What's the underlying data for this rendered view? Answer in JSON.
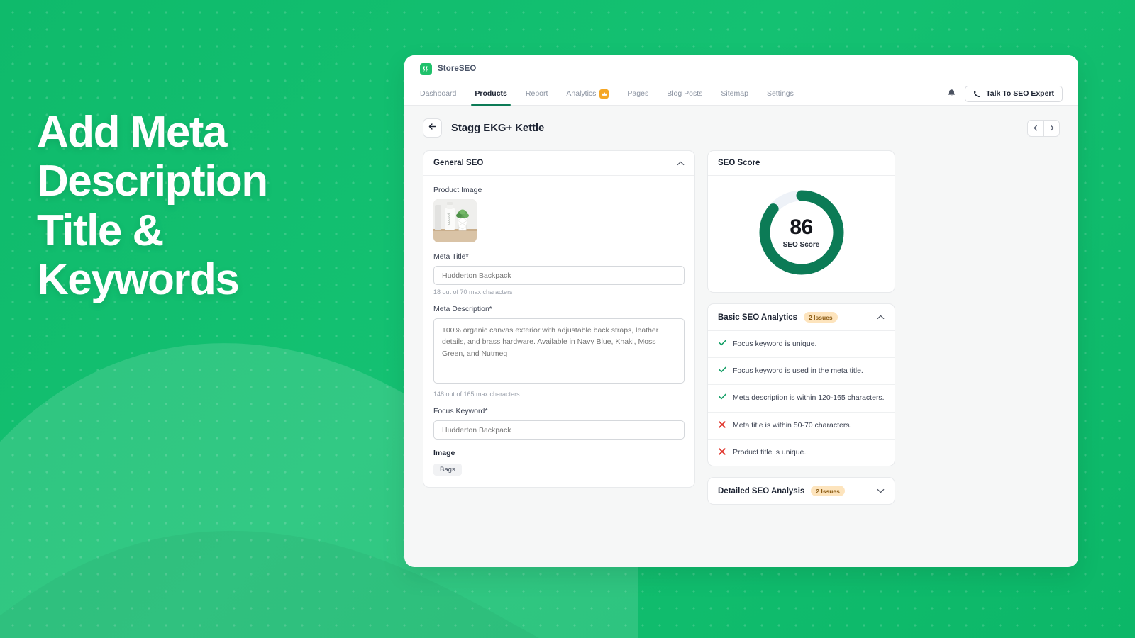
{
  "promo": {
    "headline_lines": [
      "Add Meta",
      "Description",
      "Title &",
      "Keywords"
    ]
  },
  "app": {
    "logo_text": "StoreSEO",
    "logo_icon": "storeseo-logo-icon"
  },
  "nav": {
    "items": [
      {
        "label": "Dashboard",
        "active": false,
        "badge": null
      },
      {
        "label": "Products",
        "active": true,
        "badge": null
      },
      {
        "label": "Report",
        "active": false,
        "badge": null
      },
      {
        "label": "Analytics",
        "active": false,
        "badge": "crown-icon"
      },
      {
        "label": "Pages",
        "active": false,
        "badge": null
      },
      {
        "label": "Blog Posts",
        "active": false,
        "badge": null
      },
      {
        "label": "Sitemap",
        "active": false,
        "badge": null
      },
      {
        "label": "Settings",
        "active": false,
        "badge": null
      }
    ],
    "notification_icon": "bell-icon",
    "expert_button": {
      "label": "Talk To SEO Expert",
      "icon": "phone-icon"
    }
  },
  "page": {
    "back_icon": "arrow-left-icon",
    "title": "Stagg EKG+ Kettle",
    "pager": {
      "prev_icon": "chevron-left-icon",
      "next_icon": "chevron-right-icon"
    }
  },
  "general_seo": {
    "title": "General SEO",
    "collapse_icon": "chevron-up-icon",
    "product_image_label": "Product Image",
    "product_image_alt": "cocooil bottle with succulent plant",
    "meta_title": {
      "label": "Meta Title*",
      "placeholder": "Hudderton Backpack",
      "value": "",
      "counter": "18 out of 70 max characters"
    },
    "meta_description": {
      "label": "Meta Description*",
      "placeholder": "100% organic canvas exterior with adjustable back straps, leather details, and brass hardware. Available in Navy Blue, Khaki, Moss Green, and Nutmeg",
      "value": "",
      "counter": "148 out of 165 max characters"
    },
    "focus_keyword": {
      "label": "Focus Keyword*",
      "placeholder": "Hudderton Backpack",
      "value": ""
    },
    "image": {
      "label": "Image",
      "tags": [
        "Bags"
      ]
    }
  },
  "seo_score": {
    "title": "SEO Score",
    "value": "86",
    "value_number": 86,
    "caption": "SEO Score",
    "ring_color": "#0c7b56",
    "track_color": "#eef2f8"
  },
  "basic_seo_analytics": {
    "title": "Basic SEO Analytics",
    "issues_badge": "2 Issues",
    "collapse_icon": "chevron-up-icon",
    "items": [
      {
        "status": "pass",
        "icon": "check-icon",
        "text": "Focus keyword is unique."
      },
      {
        "status": "pass",
        "icon": "check-icon",
        "text": "Focus keyword is used in the meta title."
      },
      {
        "status": "pass",
        "icon": "check-icon",
        "text": "Meta description is within 120-165 characters."
      },
      {
        "status": "fail",
        "icon": "cross-icon",
        "text": "Meta title is within 50-70 characters."
      },
      {
        "status": "fail",
        "icon": "cross-icon",
        "text": "Product title is unique."
      }
    ]
  },
  "detailed_seo_analysis": {
    "title": "Detailed SEO Analysis",
    "issues_badge": "2 Issues",
    "expand_icon": "chevron-down-icon"
  },
  "colors": {
    "brand_green": "#13bf6d",
    "dark_green": "#0c7b56",
    "badge_orange": "#f5a623",
    "pass_green": "#0f9d63",
    "fail_red": "#e0342b"
  }
}
